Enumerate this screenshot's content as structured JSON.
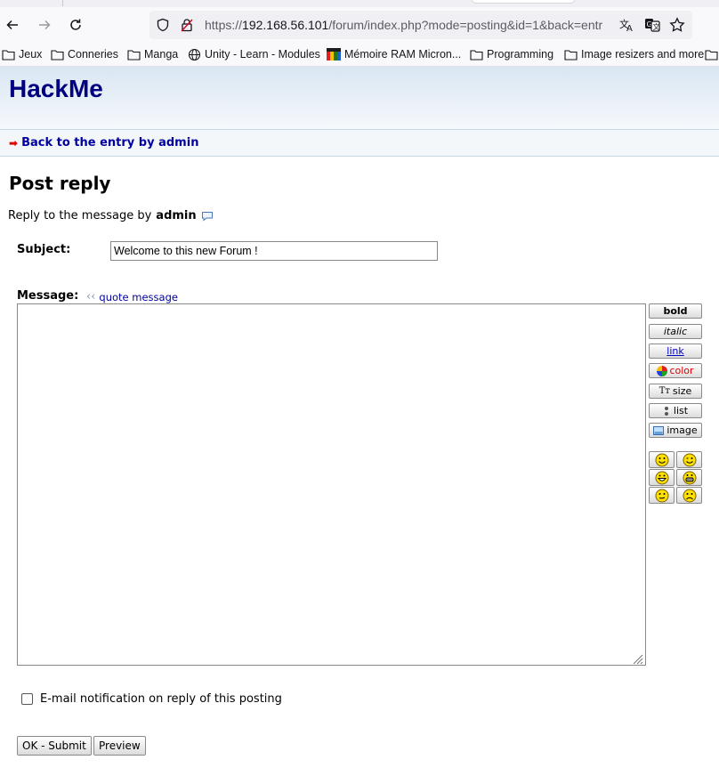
{
  "browser": {
    "url_prefix": "https://",
    "url_host": "192.168.56.101",
    "url_rest": "/forum/index.php?mode=posting&id=1&back=entr",
    "bookmarks": [
      "Jeux",
      "Conneries",
      "Manga",
      "Unity - Learn - Modules",
      "Mémoire RAM Micron...",
      "Programming",
      "Image resizers and more"
    ]
  },
  "site": {
    "title": "HackMe"
  },
  "subnav": {
    "back_label": "Back to the entry by admin"
  },
  "page": {
    "title": "Post reply",
    "reply_prefix": "Reply to the message by",
    "reply_author": "admin"
  },
  "form": {
    "subject_label": "Subject:",
    "subject_value": "Welcome to this new Forum !",
    "message_label": "Message:",
    "quote_label": "quote message",
    "message_value": "",
    "toolbar": {
      "bold": "bold",
      "italic": "italic",
      "link": "link",
      "color": "color",
      "size": "size",
      "list": "list",
      "image": "image"
    },
    "notify_label": "E-mail notification on reply of this posting",
    "submit_label": "OK - Submit",
    "preview_label": "Preview"
  },
  "colors": {
    "title": "#000080",
    "link": "#0000a0",
    "arrow": "#e00000"
  }
}
